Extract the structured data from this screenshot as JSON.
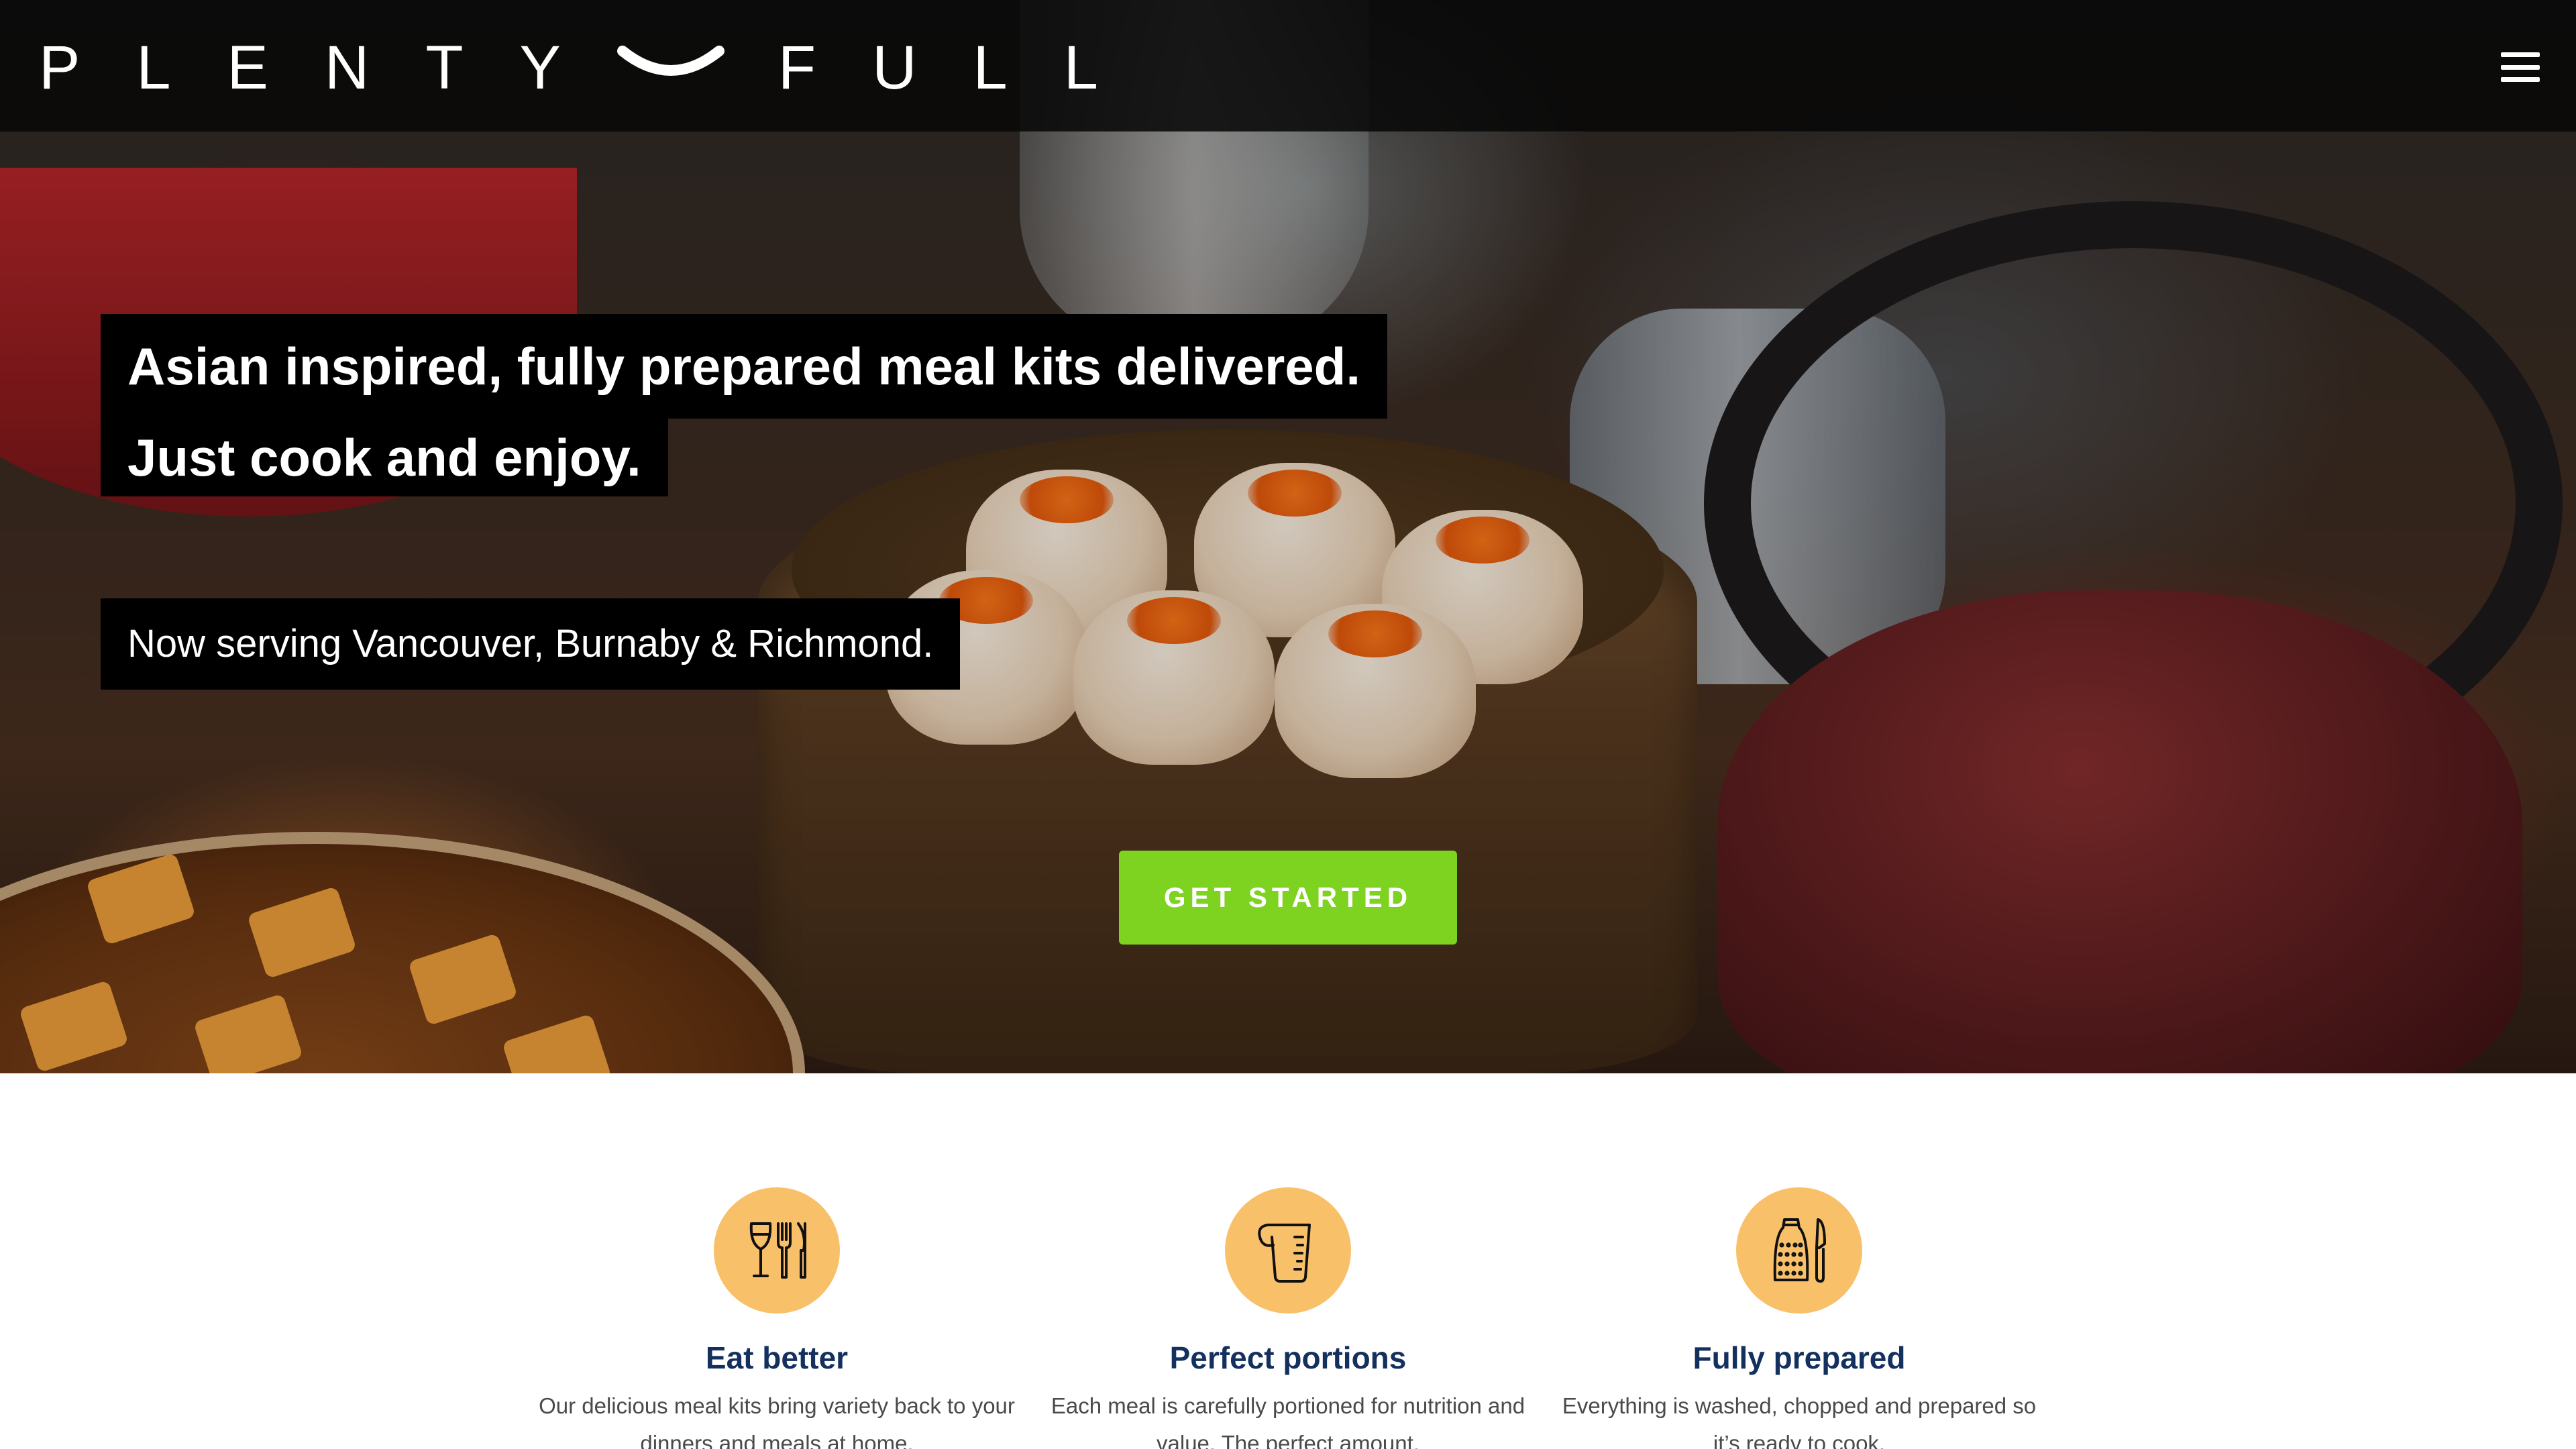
{
  "nav": {
    "logo_left": "PLENTY",
    "logo_right": "FULL",
    "menu_icon": "hamburger-menu-icon"
  },
  "hero": {
    "headline_line1": "Asian inspired, fully prepared meal kits delivered.",
    "headline_line2": "Just cook and enjoy.",
    "subline": "Now serving Vancouver, Burnaby & Richmond.",
    "cta_label": "GET STARTED",
    "cta_color": "#7ed321"
  },
  "features": [
    {
      "icon": "wine-glass-and-cutlery-icon",
      "title": "Eat better",
      "desc": "Our delicious meal kits bring variety back to your dinners and meals at home."
    },
    {
      "icon": "measuring-cup-icon",
      "title": "Perfect portions",
      "desc": "Each meal is carefully portioned for nutrition and value. The perfect amount."
    },
    {
      "icon": "grater-and-knife-icon",
      "title": "Fully prepared",
      "desc": "Everything is washed, chopped and prepared so it’s ready to cook."
    }
  ],
  "colors": {
    "accent_icon_bg": "#f9c06a",
    "feature_title": "#14305e"
  }
}
